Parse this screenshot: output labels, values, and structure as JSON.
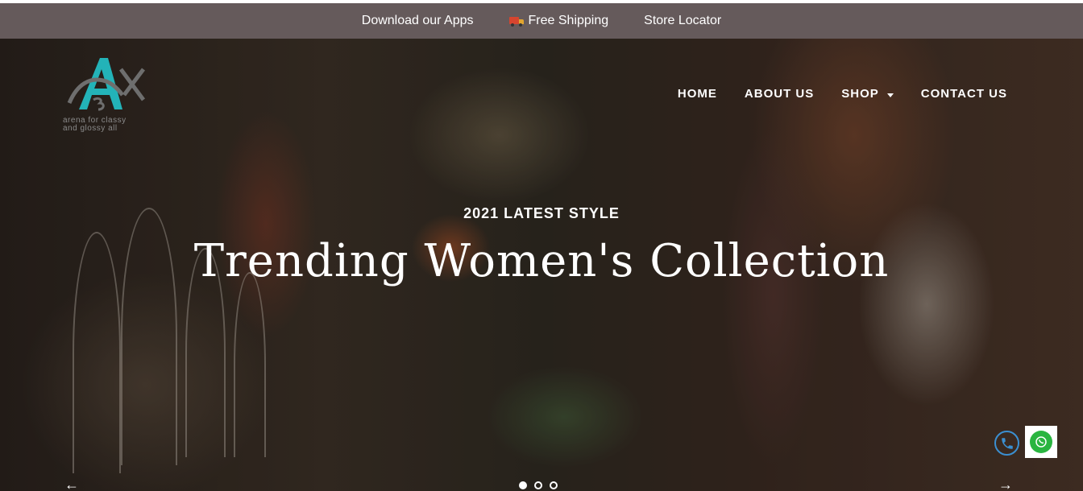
{
  "topbar": {
    "download_label": "Download our Apps",
    "shipping_label": "Free Shipping",
    "store_label": "Store Locator"
  },
  "brand": {
    "tagline_line1": "arena for classy",
    "tagline_line2": "and glossy all"
  },
  "nav": {
    "home": "HOME",
    "about": "ABOUT US",
    "shop": "SHOP",
    "contact": "CONTACT US"
  },
  "hero": {
    "subtitle": "2021 LATEST STYLE",
    "title": "Trending Women's Collection",
    "prev_arrow": "←",
    "next_arrow": "→",
    "slide_count": 3,
    "active_slide": 1
  },
  "icons": {
    "shipping": "truck-icon",
    "call": "phone-icon",
    "whatsapp": "whatsapp-icon"
  },
  "colors": {
    "topbar_bg": "#655a5b",
    "logo_teal": "#23b3b8",
    "whatsapp_green": "#2ab540",
    "phone_blue": "#3b8fd0"
  }
}
